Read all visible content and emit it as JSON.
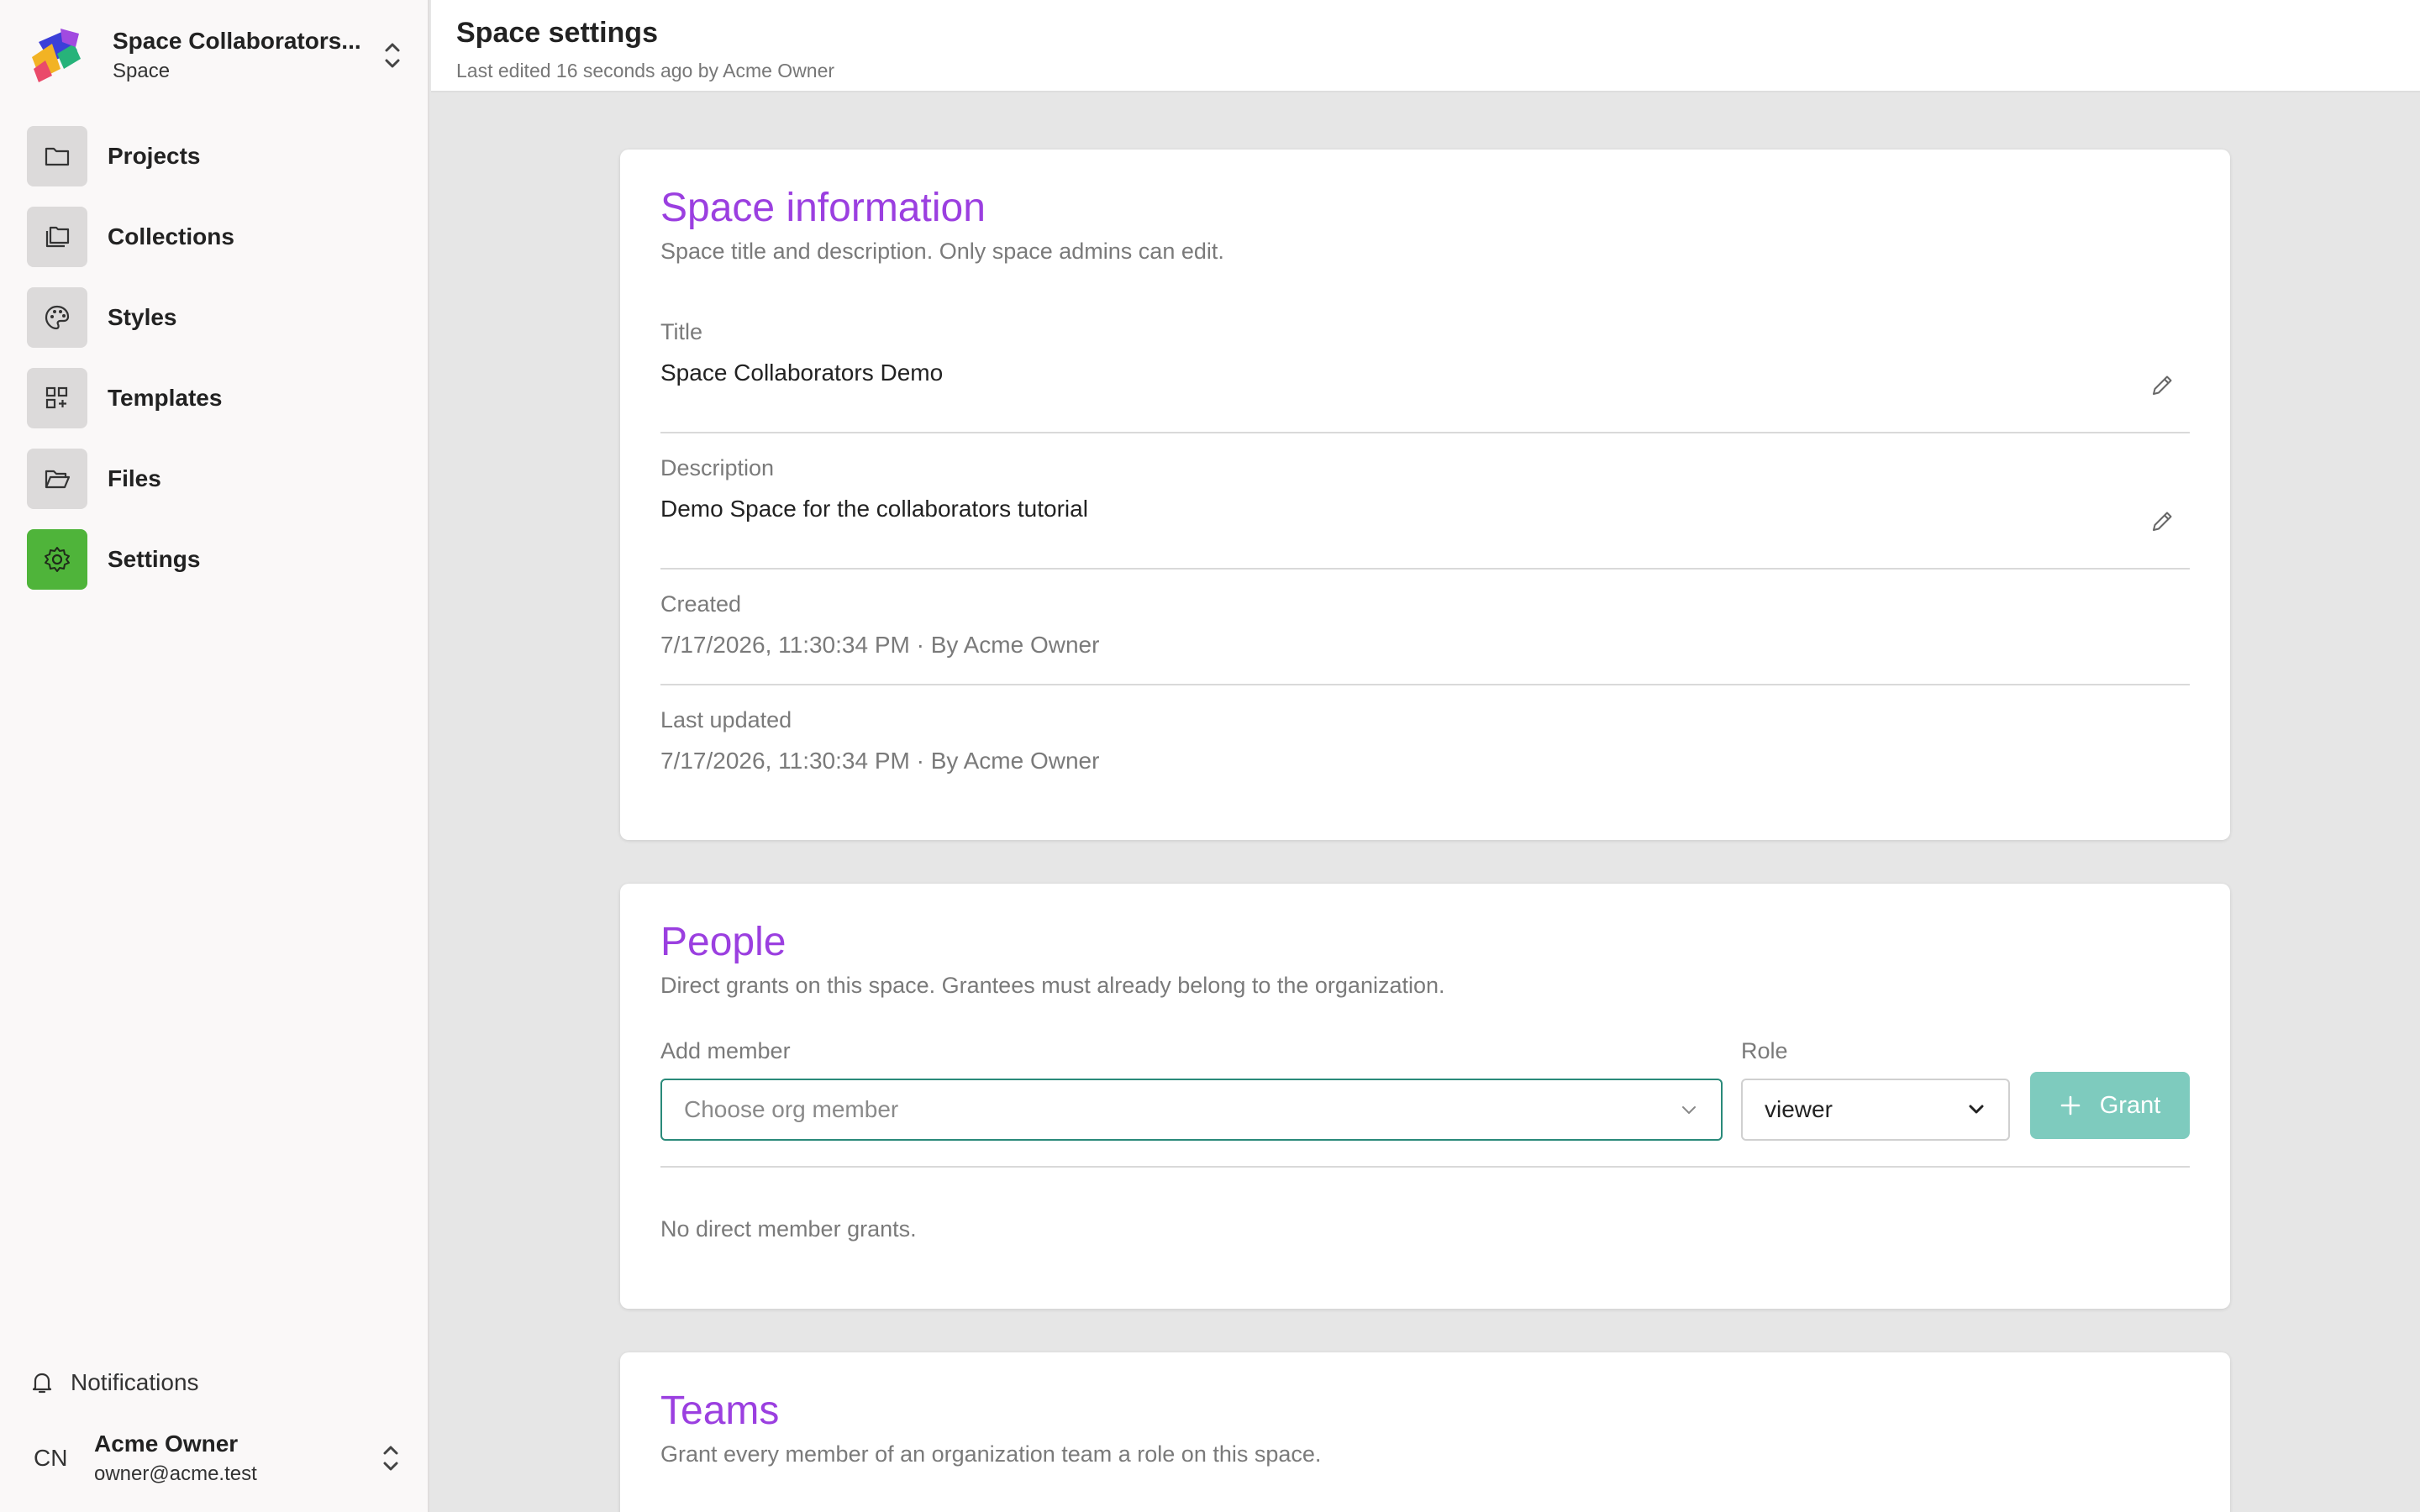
{
  "sidebar": {
    "space_name": "Space Collaborators...",
    "space_type": "Space",
    "items": [
      {
        "label": "Projects",
        "icon": "folder-icon"
      },
      {
        "label": "Collections",
        "icon": "collections-icon"
      },
      {
        "label": "Styles",
        "icon": "palette-icon"
      },
      {
        "label": "Templates",
        "icon": "templates-icon"
      },
      {
        "label": "Files",
        "icon": "folder-open-icon"
      },
      {
        "label": "Settings",
        "icon": "gear-icon",
        "active": true
      }
    ],
    "notifications_label": "Notifications",
    "user": {
      "initials": "CN",
      "name": "Acme Owner",
      "email": "owner@acme.test"
    }
  },
  "header": {
    "title": "Space settings",
    "subtitle": "Last edited 16 seconds ago by Acme Owner"
  },
  "space_info": {
    "title": "Space information",
    "description": "Space title and description. Only space admins can edit.",
    "title_label": "Title",
    "title_value": "Space Collaborators Demo",
    "description_label": "Description",
    "description_value": "Demo Space for the collaborators tutorial",
    "created_label": "Created",
    "created_value": "7/17/2026, 11:30:34 PM · By Acme Owner",
    "updated_label": "Last updated",
    "updated_value": "7/17/2026, 11:30:34 PM · By Acme Owner"
  },
  "people": {
    "title": "People",
    "description": "Direct grants on this space. Grantees must already belong to the organization.",
    "add_member_label": "Add member",
    "member_placeholder": "Choose org member",
    "role_label": "Role",
    "role_value": "viewer",
    "grant_label": "Grant",
    "empty_text": "No direct member grants."
  },
  "teams": {
    "title": "Teams",
    "description": "Grant every member of an organization team a role on this space."
  },
  "colors": {
    "accent_purple": "#9b3fe0",
    "active_green": "#4fb43a",
    "grant_teal": "#7ecbbe",
    "focus_teal": "#2a8a7a"
  }
}
